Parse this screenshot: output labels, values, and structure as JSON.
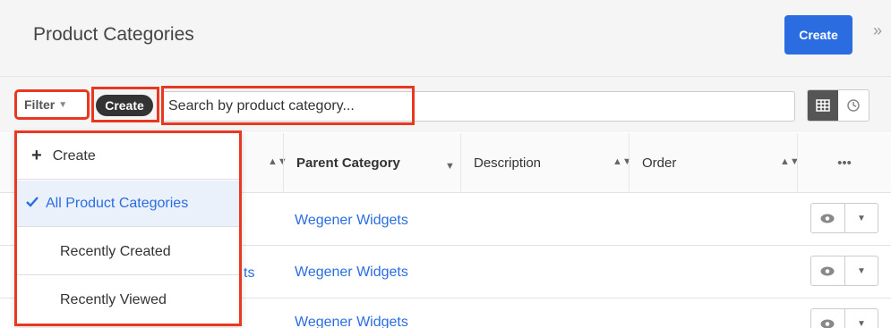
{
  "header": {
    "title": "Product Categories",
    "create_label": "Create",
    "collapse_glyph": "»"
  },
  "filterbar": {
    "filter_label": "Filter",
    "pill_label": "Create",
    "search_placeholder": "Search by product category...",
    "view_icons": [
      "list-view-icon",
      "activity-stream-icon"
    ]
  },
  "table": {
    "columns": [
      {
        "label": "Parent Category",
        "bold": true
      },
      {
        "label": "Description",
        "bold": false
      },
      {
        "label": "Order",
        "bold": false
      },
      {
        "label": "•••",
        "bold": false
      }
    ],
    "rows": [
      {
        "name_partial": "",
        "parent": "Wegener Widgets"
      },
      {
        "name_partial": "ts",
        "parent": "Wegener Widgets"
      },
      {
        "name_partial": "",
        "parent": "Wegener Widgets"
      }
    ]
  },
  "dropdown": {
    "create_label": "Create",
    "items": [
      {
        "label": "All Product Categories",
        "selected": true
      },
      {
        "label": "Recently Created",
        "selected": false
      },
      {
        "label": "Recently Viewed",
        "selected": false
      }
    ]
  },
  "colors": {
    "accent": "#2b6de1",
    "highlight": "#e8381f"
  }
}
